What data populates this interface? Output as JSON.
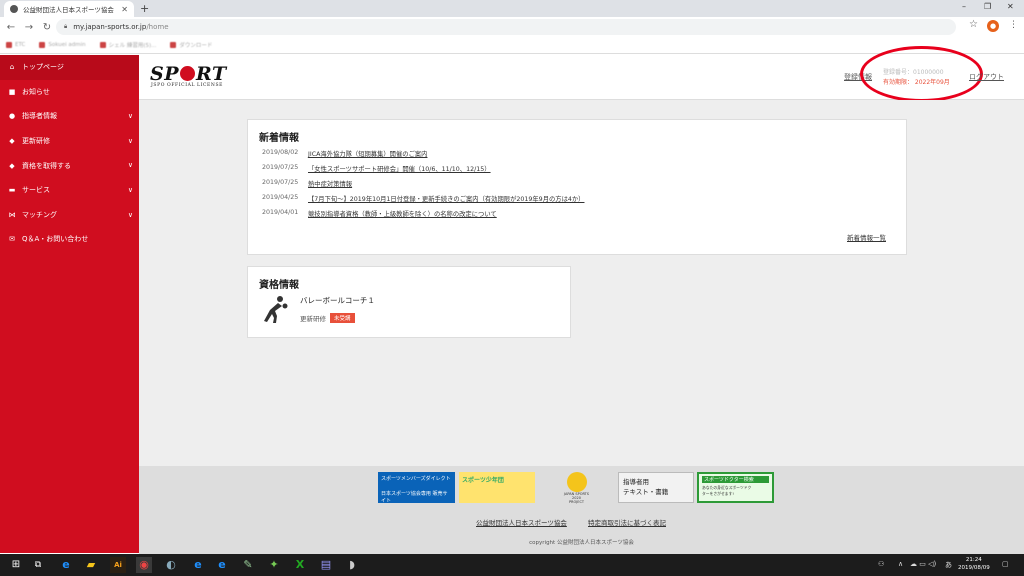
{
  "browser": {
    "tab_title": "公益財団法人日本スポーツ協会",
    "new_tab": "+",
    "url_domain": "my.japan-sports.or.jp",
    "url_path": "/home",
    "window_controls": [
      "–",
      "❐",
      "✕"
    ],
    "bookmarks": [
      "ETC",
      "Sokuei admin",
      "シェル 練習用(5)...",
      "ダウンロード"
    ]
  },
  "sidebar": {
    "items": [
      {
        "label": "トップページ",
        "icon": "home-icon",
        "chevron": false
      },
      {
        "label": "お知らせ",
        "icon": "comment-icon",
        "chevron": false
      },
      {
        "label": "指導者情報",
        "icon": "user-icon",
        "chevron": true
      },
      {
        "label": "更新研修",
        "icon": "tag-icon",
        "chevron": true
      },
      {
        "label": "資格を取得する",
        "icon": "tag-icon",
        "chevron": true
      },
      {
        "label": "サービス",
        "icon": "briefcase-icon",
        "chevron": true
      },
      {
        "label": "マッチング",
        "icon": "handshake-icon",
        "chevron": true
      },
      {
        "label": "Q＆A・お問い合わせ",
        "icon": "mail-icon",
        "chevron": false
      }
    ]
  },
  "header": {
    "logo_text_1": "SP",
    "logo_text_2": "RT",
    "logo_sub": "JSPO OFFICIAL LICENSE",
    "link_register": "登録情報",
    "license_number": "登録番号：01000000",
    "license_expiry": "有効期限： 2022年09月",
    "logout": "ログアウト"
  },
  "news": {
    "title": "新着情報",
    "items": [
      {
        "date": "2019/08/02",
        "title": "JICA海外協力隊（短期募集）開催のご案内"
      },
      {
        "date": "2019/07/25",
        "title": "「女性スポーツサポート研修会」開催（10/6、11/10、12/15）"
      },
      {
        "date": "2019/07/25",
        "title": "熱中症対策情報"
      },
      {
        "date": "2019/04/25",
        "title": "【7月下旬〜】2019年10月1日付登録・更新手続きのご案内（有効期限が2019年9月の方は4か）"
      },
      {
        "date": "2019/04/01",
        "title": "競技別指導者資格（教師・上級教師を除く）の名称の改定について"
      }
    ],
    "more_link": "新着情報一覧"
  },
  "qualification": {
    "title": "資格情報",
    "name": "バレーボールコーチ１",
    "status_label": "更新研修",
    "status_badge": "未受講"
  },
  "footer": {
    "banners": [
      {
        "line1": "スポーツメンバーズダイレクト",
        "line2": "日本スポーツ協会専用 販売サイト"
      },
      {
        "line1": "スポーツ少年団",
        "line2": ""
      },
      {
        "line1": "JAPAN SPORTS 2020",
        "line2": "PROJECT"
      },
      {
        "line1": "指導者用",
        "line2": "テキスト・書籍"
      },
      {
        "line1": "スポーツドクター検索",
        "line2": "あなたの身近なスポーツドクターをさがせます!"
      }
    ],
    "link_association": "公益財団法人日本スポーツ協会",
    "link_law": "特定商取引法に基づく表記",
    "copyright": "copyright 公益財団法人日本スポーツ協会"
  },
  "taskbar": {
    "time": "21:24",
    "date": "2019/08/09",
    "ime": "あ"
  },
  "colors": {
    "brand_red": "#d00d1f",
    "annotation_red": "#e8001c",
    "expiry_text": "#e8503a"
  }
}
